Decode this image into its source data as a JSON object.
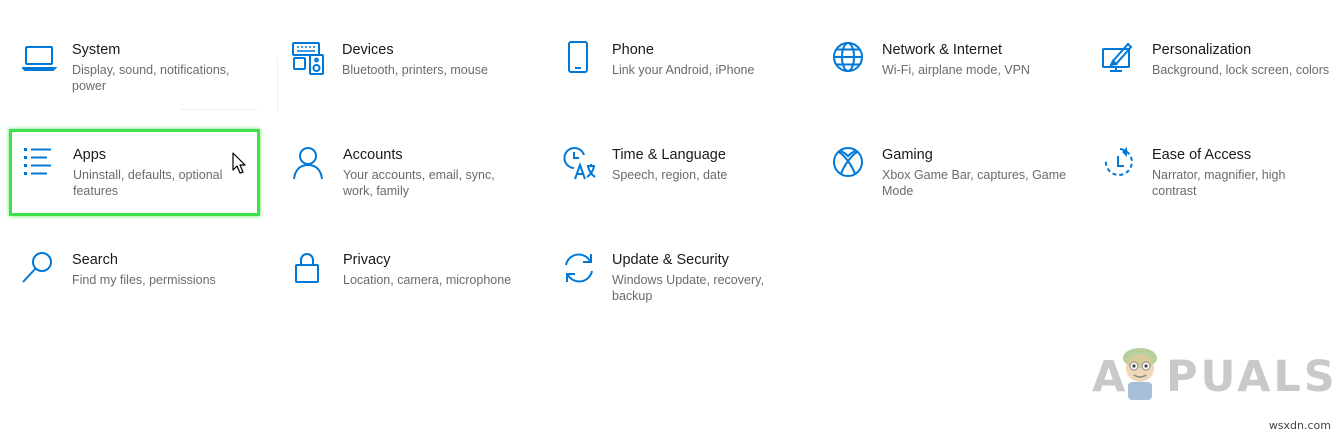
{
  "accent_color": "#0078d7",
  "highlight_color": "#3ee04a",
  "tiles": [
    {
      "title": "System",
      "desc": "Display, sound, notifications,\npower",
      "icon": "laptop-icon"
    },
    {
      "title": "Devices",
      "desc": "Bluetooth, printers, mouse",
      "icon": "devices-icon"
    },
    {
      "title": "Phone",
      "desc": "Link your Android, iPhone",
      "icon": "phone-icon"
    },
    {
      "title": "Network & Internet",
      "desc": "Wi-Fi, airplane mode, VPN",
      "icon": "globe-icon"
    },
    {
      "title": "Personalization",
      "desc": "Background, lock screen, colors",
      "icon": "personalization-icon"
    },
    {
      "title": "Apps",
      "desc": "Uninstall, defaults, optional\nfeatures",
      "icon": "apps-list-icon"
    },
    {
      "title": "Accounts",
      "desc": "Your accounts, email, sync,\nwork, family",
      "icon": "person-icon"
    },
    {
      "title": "Time & Language",
      "desc": "Speech, region, date",
      "icon": "time-language-icon"
    },
    {
      "title": "Gaming",
      "desc": "Xbox Game Bar, captures, Game\nMode",
      "icon": "xbox-icon"
    },
    {
      "title": "Ease of Access",
      "desc": "Narrator, magnifier, high\ncontrast",
      "icon": "ease-of-access-icon"
    },
    {
      "title": "Search",
      "desc": "Find my files, permissions",
      "icon": "search-icon"
    },
    {
      "title": "Privacy",
      "desc": "Location, camera, microphone",
      "icon": "lock-icon"
    },
    {
      "title": "Update & Security",
      "desc": "Windows Update, recovery,\nbackup",
      "icon": "refresh-icon"
    }
  ],
  "watermark": {
    "left": "A",
    "right": "PUALS"
  },
  "footer": "wsxdn.com"
}
